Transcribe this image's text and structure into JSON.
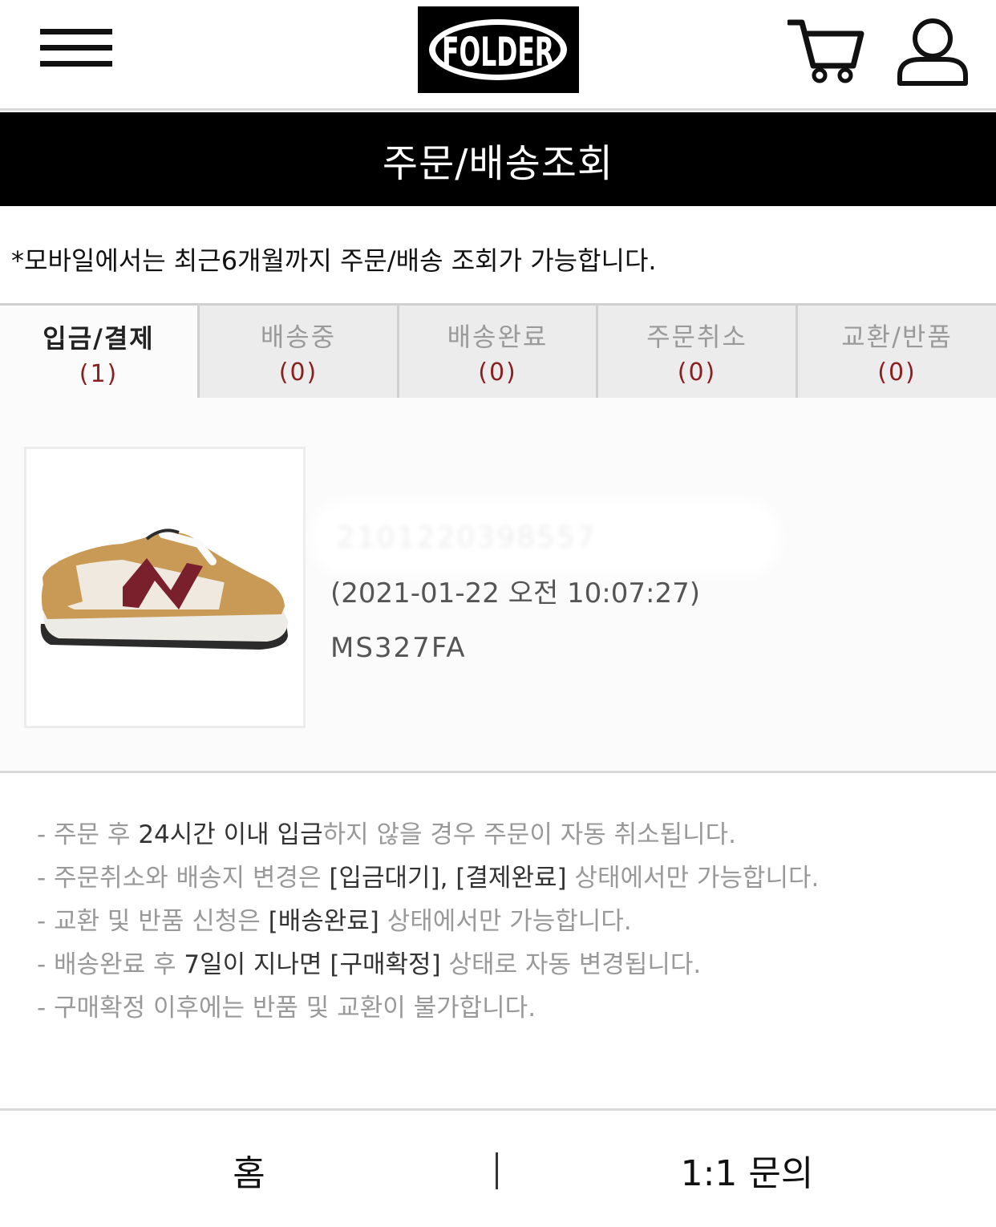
{
  "header": {
    "menu_icon": "hamburger-icon",
    "logo_text": "FOLDER",
    "cart_icon": "cart-icon",
    "user_icon": "user-icon"
  },
  "page_title": "주문/배송조회",
  "notice": "*모바일에서는 최근6개월까지 주문/배송 조회가 가능합니다.",
  "tabs": [
    {
      "label": "입금/결제",
      "count": "(1)"
    },
    {
      "label": "배송중",
      "count": "(0)"
    },
    {
      "label": "배송완료",
      "count": "(0)"
    },
    {
      "label": "주문취소",
      "count": "(0)"
    },
    {
      "label": "교환/반품",
      "count": "(0)"
    }
  ],
  "order": {
    "order_number": "2101220398557",
    "date": "(2021-01-22 오전 10:07:27)",
    "model": "MS327FA"
  },
  "info": [
    {
      "prefix": "- 주문 후 ",
      "hl": "24시간 이내 입금",
      "suffix": "하지 않을 경우 주문이 자동 취소됩니다."
    },
    {
      "prefix": "- 주문취소와 배송지 변경은 ",
      "hl": "[입금대기], [결제완료]",
      "suffix": " 상태에서만 가능합니다."
    },
    {
      "prefix": "- 교환 및 반품 신청은 ",
      "hl": "[배송완료]",
      "suffix": " 상태에서만 가능합니다."
    },
    {
      "prefix": "- 배송완료 후 ",
      "hl": "7일이 지나면 [구매확정]",
      "suffix": " 상태로 자동 변경됩니다."
    },
    {
      "prefix": "- 구매확정 이후에는 반품 및 교환이 불가합니다.",
      "hl": "",
      "suffix": ""
    }
  ],
  "footer": {
    "home": "홈",
    "inquiry": "1:1 문의"
  },
  "colors": {
    "accent_count": "#8b2020",
    "title_bar": "#000000"
  }
}
